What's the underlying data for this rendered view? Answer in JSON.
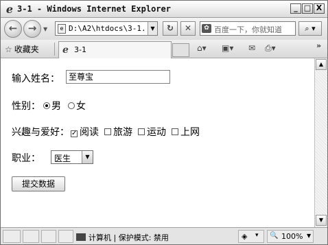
{
  "window": {
    "title": "3-1 - Windows Internet Explorer",
    "minimize": "_",
    "maximize": "□",
    "close": "X"
  },
  "address": {
    "url": "D:\\A2\\htdocs\\3-1.h",
    "back_icon": "back-arrow-icon",
    "forward_icon": "forward-arrow-icon",
    "refresh_symbol": "↻",
    "stop_symbol": "✕"
  },
  "search": {
    "placeholder": "百度一下，你就知道",
    "go_symbol": "⌕ ▾"
  },
  "favorites": {
    "label": "收藏夹",
    "star": "☆"
  },
  "tab": {
    "title": "3-1"
  },
  "commandbar": {
    "home": "⌂▾",
    "feeds": "▣▾",
    "mail": "✉",
    "print": "⎙▾",
    "more": "»"
  },
  "form": {
    "name_label": "输入姓名：",
    "name_value": "至尊宝",
    "gender_label": "性别：",
    "gender_options": [
      "男",
      "女"
    ],
    "gender_selected": "男",
    "hobby_label": "兴趣与爱好：",
    "hobbies": [
      {
        "label": "阅读",
        "checked": true
      },
      {
        "label": "旅游",
        "checked": false
      },
      {
        "label": "运动",
        "checked": false
      },
      {
        "label": "上网",
        "checked": false
      }
    ],
    "job_label": "职业：",
    "job_selected": "医生",
    "submit_label": "提交数据"
  },
  "status": {
    "zone_text": "计算机 | 保护模式: 禁用",
    "zoom": "100%",
    "zoom_prefix": "🔍",
    "security": "▾"
  }
}
